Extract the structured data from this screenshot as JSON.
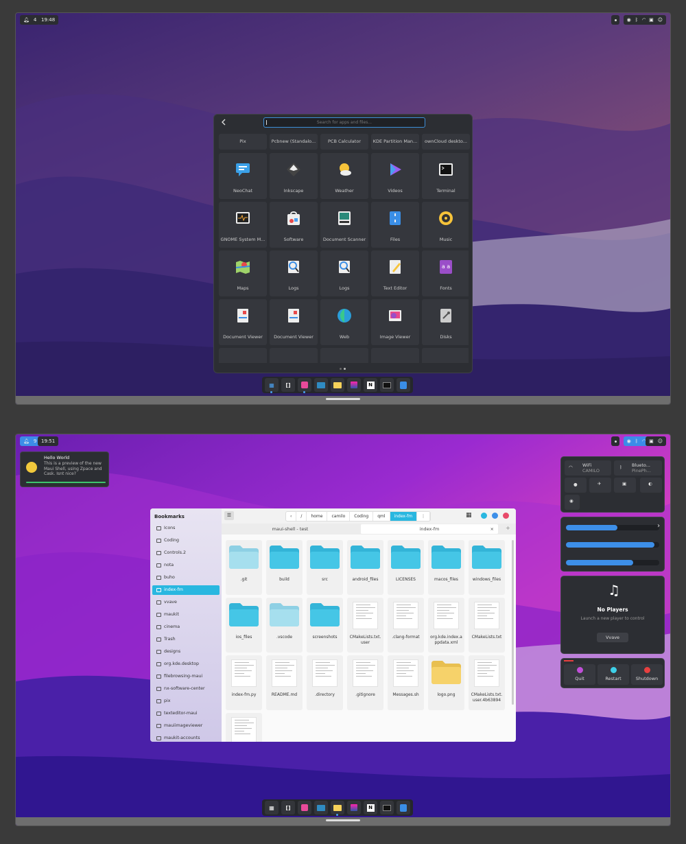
{
  "screen1": {
    "topbar": {
      "notif_count": "4",
      "clock": "19:48"
    },
    "launcher": {
      "search_placeholder": "Search for apps and files...",
      "name_row": [
        "Pix",
        "Pcbnew (Standalo...",
        "PCB Calculator",
        "KDE Partition Man...",
        "ownCloud deskto..."
      ],
      "apps": [
        {
          "label": "NeoChat",
          "icon": "neochat-icon"
        },
        {
          "label": "Inkscape",
          "icon": "inkscape-icon"
        },
        {
          "label": "Weather",
          "icon": "weather-icon"
        },
        {
          "label": "Videos",
          "icon": "videos-icon"
        },
        {
          "label": "Terminal",
          "icon": "terminal-icon"
        },
        {
          "label": "GNOME System M...",
          "icon": "system-monitor-icon"
        },
        {
          "label": "Software",
          "icon": "software-icon"
        },
        {
          "label": "Document Scanner",
          "icon": "scanner-icon"
        },
        {
          "label": "Files",
          "icon": "files-icon"
        },
        {
          "label": "Music",
          "icon": "music-icon"
        },
        {
          "label": "Maps",
          "icon": "maps-icon"
        },
        {
          "label": "Logs",
          "icon": "logs-icon"
        },
        {
          "label": "Logs",
          "icon": "logs-icon"
        },
        {
          "label": "Text Editor",
          "icon": "text-editor-icon"
        },
        {
          "label": "Fonts",
          "icon": "fonts-icon"
        },
        {
          "label": "Document Viewer",
          "icon": "document-viewer-icon"
        },
        {
          "label": "Document Viewer",
          "icon": "document-viewer-icon"
        },
        {
          "label": "Web",
          "icon": "web-icon"
        },
        {
          "label": "Image Viewer",
          "icon": "image-viewer-icon"
        },
        {
          "label": "Disks",
          "icon": "disks-icon"
        },
        {
          "label": "",
          "icon": "app-icon"
        },
        {
          "label": "",
          "icon": "app-icon"
        },
        {
          "label": "",
          "icon": "app-icon"
        },
        {
          "label": "",
          "icon": "app-icon"
        },
        {
          "label": "",
          "icon": "app-icon"
        }
      ]
    }
  },
  "screen2": {
    "topbar": {
      "notif_count": "9",
      "clock": "19:51"
    },
    "notification": {
      "title": "Hello World",
      "body": "This is a preview of the new Maui Shell, using Zpace and Cask. Isnt nice?"
    },
    "file_manager": {
      "bookmarks_title": "Bookmarks",
      "bookmarks": [
        "Icons",
        "Coding",
        "Controls.2",
        "nota",
        "buho",
        "index-fm",
        "vvave",
        "maukit",
        "cinema",
        "Trash",
        "designs",
        "org.kde.desktop",
        "filebrowsing-maui",
        "nx-software-center",
        "pix",
        "texteditor-maui",
        "mauiimageviewer",
        "maukit-accounts"
      ],
      "selected_bookmark": "index-fm",
      "breadcrumbs": [
        "/",
        "home",
        "camilo",
        "Coding",
        "qml",
        "index-fm"
      ],
      "tabs": [
        "maui-shell  -  test",
        "index-fm"
      ],
      "files": [
        {
          "name": ".git",
          "kind": "folder-light"
        },
        {
          "name": "build",
          "kind": "folder"
        },
        {
          "name": "src",
          "kind": "folder"
        },
        {
          "name": "android_files",
          "kind": "folder"
        },
        {
          "name": "LICENSES",
          "kind": "folder"
        },
        {
          "name": "macos_files",
          "kind": "folder"
        },
        {
          "name": "windows_files",
          "kind": "folder"
        },
        {
          "name": "ios_files",
          "kind": "folder"
        },
        {
          "name": ".vscode",
          "kind": "folder-light"
        },
        {
          "name": "screenshots",
          "kind": "folder"
        },
        {
          "name": "CMakeLists.txt.user",
          "kind": "doc"
        },
        {
          "name": ".clang-format",
          "kind": "doc"
        },
        {
          "name": "org.kde.index.appdata.xml",
          "kind": "doc"
        },
        {
          "name": "CMakeLists.txt",
          "kind": "doc"
        },
        {
          "name": "index-fm.py",
          "kind": "doc"
        },
        {
          "name": "README.md",
          "kind": "doc"
        },
        {
          "name": ".directory",
          "kind": "doc"
        },
        {
          "name": ".gitignore",
          "kind": "doc"
        },
        {
          "name": "Messages.sh",
          "kind": "doc"
        },
        {
          "name": "logo.png",
          "kind": "folder-yellow"
        },
        {
          "name": "CMakeLists.txt.user.4b63894",
          "kind": "doc"
        },
        {
          "name": "",
          "kind": "doc"
        }
      ]
    },
    "quick_settings": {
      "wifi_label": "WiFi",
      "wifi_value": "CAMILO",
      "bluetooth_label": "Blueto...",
      "bluetooth_value": "PinePh...",
      "volume_level": 0.55,
      "brightness_level": 0.95,
      "mic_level": 0.72
    },
    "player": {
      "title": "No Players",
      "subtitle": "Launch a new player to control",
      "button": "Vvave"
    },
    "session": {
      "quit": "Quit",
      "restart": "Restart",
      "shutdown": "Shutdown"
    },
    "colors": {
      "accent": "#29b7e0",
      "blue": "#3d8fe8",
      "quit": "#c04fd8",
      "restart": "#3ed0e8",
      "shutdown": "#e84040"
    }
  }
}
